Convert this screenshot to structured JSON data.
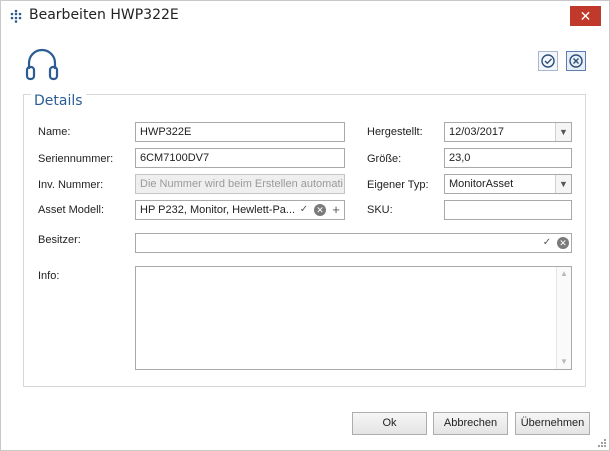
{
  "window": {
    "title": "Bearbeiten HWP322E",
    "close_glyph": "✕"
  },
  "icons": {
    "app": "grid-dots-icon",
    "asset": "headset-icon",
    "save": "check-circle-icon",
    "cancel": "x-circle-icon"
  },
  "details": {
    "legend": "Details",
    "name": {
      "label": "Name:",
      "value": "HWP322E"
    },
    "serial": {
      "label": "Seriennummer:",
      "value": "6CM7100DV7"
    },
    "inv": {
      "label": "Inv. Nummer:",
      "placeholder": "Die Nummer wird beim Erstellen automati..."
    },
    "model": {
      "label": "Asset Modell:",
      "value": "HP P232, Monitor, Hewlett-Pa..."
    },
    "manufactured": {
      "label": "Hergestellt:",
      "value": "12/03/2017"
    },
    "size": {
      "label": "Größe:",
      "value": "23,0"
    },
    "own_type": {
      "label": "Eigener Typ:",
      "value": "MonitorAsset"
    },
    "sku": {
      "label": "SKU:",
      "value": ""
    },
    "owner": {
      "label": "Besitzer:",
      "value": ""
    },
    "info": {
      "label": "Info:",
      "value": ""
    }
  },
  "buttons": {
    "ok": "Ok",
    "cancel": "Abbrechen",
    "apply": "Übernehmen"
  },
  "colors": {
    "accent": "#2b5c93",
    "close": "#c0392b"
  }
}
